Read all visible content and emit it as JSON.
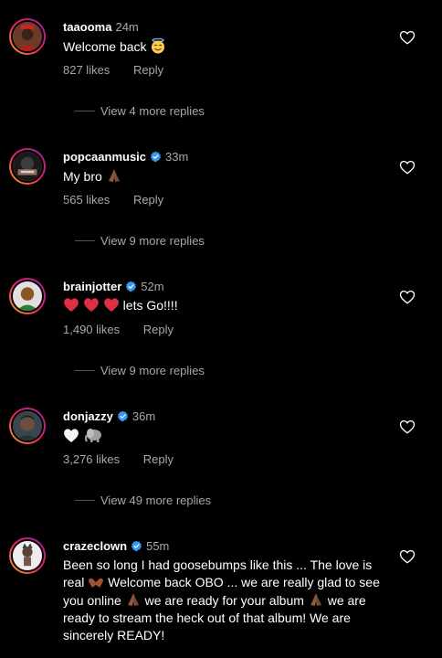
{
  "colors": {
    "background": "#000000",
    "primary_text": "#ffffff",
    "secondary_text": "#a8a8a8",
    "verified_blue": "#3897f0",
    "divider": "#555555"
  },
  "comments": [
    {
      "username": "taaooma",
      "verified": false,
      "time": "24m",
      "text": "Welcome back",
      "emoji": [
        "smiling-face-with-halo"
      ],
      "likes": "827 likes",
      "reply_label": "Reply",
      "view_more": "View 4 more replies",
      "avatar_icon": "taaooma-avatar"
    },
    {
      "username": "popcaanmusic",
      "verified": true,
      "time": "33m",
      "text": "My bro",
      "emoji": [
        "folded-hands"
      ],
      "likes": "565 likes",
      "reply_label": "Reply",
      "view_more": "View 9 more replies",
      "avatar_icon": "popcaanmusic-avatar"
    },
    {
      "username": "brainjotter",
      "verified": true,
      "time": "52m",
      "text_prefix_emoji": [
        "red-heart",
        "red-heart",
        "red-heart"
      ],
      "text": "lets Go!!!!",
      "likes": "1,490 likes",
      "reply_label": "Reply",
      "view_more": "View 9 more replies",
      "avatar_icon": "brainjotter-avatar"
    },
    {
      "username": "donjazzy",
      "verified": true,
      "time": "36m",
      "text": "",
      "emoji": [
        "white-heart",
        "elephant"
      ],
      "likes": "3,276 likes",
      "reply_label": "Reply",
      "view_more": "View 49 more replies",
      "avatar_icon": "donjazzy-avatar"
    },
    {
      "username": "crazeclown",
      "verified": true,
      "time": "55m",
      "text_parts": [
        "Been so long I had goosebumps like this ... The love is real ",
        " Welcome back OBO ... we are really glad to see you online ",
        " we are ready for your album ",
        " we are ready to stream the heck out of that album! We are sincerely READY!"
      ],
      "emoji": [
        "heart-hands",
        "folded-hands",
        "folded-hands"
      ],
      "avatar_icon": "crazeclown-avatar"
    }
  ],
  "icons": {
    "like": "heart-outline-icon",
    "verified": "verified-badge-icon"
  }
}
